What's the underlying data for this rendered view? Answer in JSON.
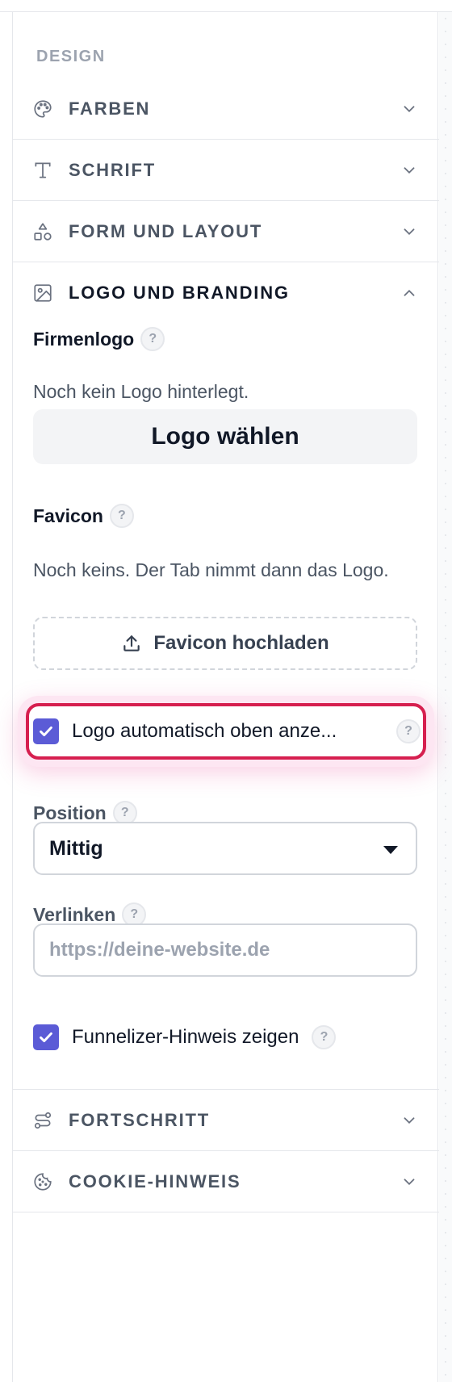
{
  "panel": {
    "section_label": "DESIGN",
    "accordion": [
      {
        "label": "FARBEN",
        "icon": "palette-icon",
        "expanded": false
      },
      {
        "label": "SCHRIFT",
        "icon": "type-icon",
        "expanded": false
      },
      {
        "label": "FORM UND LAYOUT",
        "icon": "shapes-icon",
        "expanded": false
      },
      {
        "label": "LOGO UND BRANDING",
        "icon": "image-icon",
        "expanded": true
      },
      {
        "label": "FORTSCHRITT",
        "icon": "route-icon",
        "expanded": false
      },
      {
        "label": "COOKIE-HINWEIS",
        "icon": "cookie-icon",
        "expanded": false
      }
    ]
  },
  "branding": {
    "company_logo": {
      "title": "Firmenlogo",
      "help": "?",
      "status": "Noch kein Logo hinterlegt.",
      "button": "Logo wählen"
    },
    "favicon": {
      "title": "Favicon",
      "help": "?",
      "status": "Noch keins. Der Tab nimmt dann das Logo.",
      "button": "Favicon hochladen"
    },
    "auto_logo": {
      "label": "Logo automatisch oben anze...",
      "checked": true,
      "help": "?"
    },
    "position": {
      "label": "Position",
      "help": "?",
      "value": "Mittig"
    },
    "link": {
      "label": "Verlinken",
      "help": "?",
      "placeholder": "https://deine-website.de",
      "value": ""
    },
    "funnelizer_hint": {
      "label": "Funnelizer-Hinweis zeigen",
      "checked": true,
      "help": "?"
    }
  },
  "colors": {
    "accent": "#5b5bd6",
    "highlight": "#d61f4f"
  }
}
